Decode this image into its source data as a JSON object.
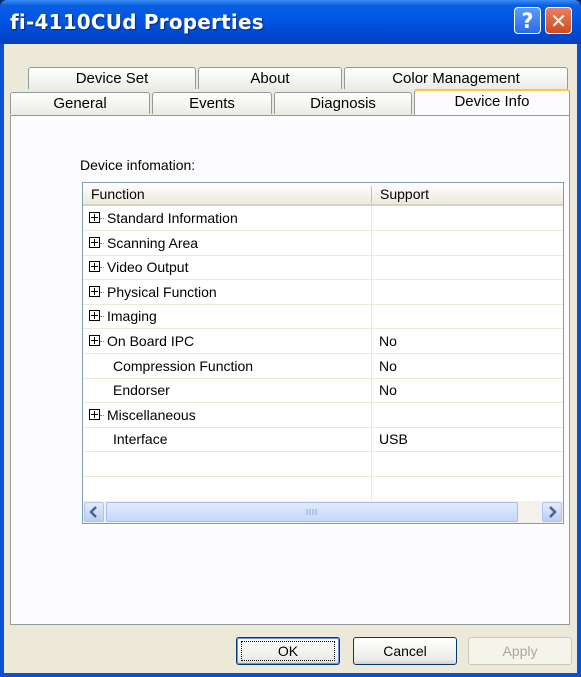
{
  "window": {
    "title": "fi-4110CUd Properties",
    "help_glyph": "?",
    "close_glyph": "✕"
  },
  "tabs_top": [
    {
      "label": "Device Set"
    },
    {
      "label": "About"
    },
    {
      "label": "Color Management"
    }
  ],
  "tabs_bottom": [
    {
      "label": "General"
    },
    {
      "label": "Events"
    },
    {
      "label": "Diagnosis"
    },
    {
      "label": "Device Info",
      "active": true
    }
  ],
  "device_info": {
    "label": "Device infomation:",
    "columns": [
      "Function",
      "Support"
    ],
    "rows": [
      {
        "function": "Standard Information",
        "support": "",
        "expandable": true
      },
      {
        "function": "Scanning Area",
        "support": "",
        "expandable": true
      },
      {
        "function": "Video Output",
        "support": "",
        "expandable": true
      },
      {
        "function": "Physical Function",
        "support": "",
        "expandable": true
      },
      {
        "function": "Imaging",
        "support": "",
        "expandable": true
      },
      {
        "function": "On Board IPC",
        "support": "No",
        "expandable": true
      },
      {
        "function": "Compression Function",
        "support": "No",
        "expandable": false
      },
      {
        "function": "Endorser",
        "support": "No",
        "expandable": false
      },
      {
        "function": "Miscellaneous",
        "support": "",
        "expandable": true
      },
      {
        "function": "Interface",
        "support": "USB",
        "expandable": false
      },
      {
        "function": "",
        "support": "",
        "expandable": false
      },
      {
        "function": "",
        "support": "",
        "expandable": false
      }
    ]
  },
  "buttons": {
    "ok": "OK",
    "cancel": "Cancel",
    "apply": "Apply"
  },
  "colors": {
    "title_bar": "#0055e5",
    "dialog_bg": "#ece9d8",
    "tab_highlight": "#ffc83c",
    "close_btn": "#d24b1f"
  }
}
